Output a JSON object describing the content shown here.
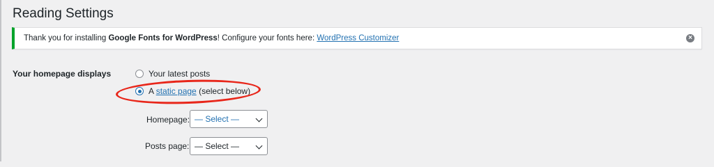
{
  "page": {
    "title": "Reading Settings"
  },
  "notice": {
    "text_prefix": "Thank you for installing ",
    "plugin_name": "Google Fonts for WordPress",
    "text_middle": "! Configure your fonts here: ",
    "link_text": "WordPress Customizer",
    "dismiss_glyph": "×",
    "accent_color": "#00a32a"
  },
  "homepage_displays": {
    "label": "Your homepage displays",
    "options": [
      {
        "label": "Your latest posts",
        "checked": false
      },
      {
        "prefix": "A ",
        "link": "static page",
        "suffix": " (select below)",
        "checked": true
      }
    ],
    "annotation_color": "#e8261a"
  },
  "homepage_select": {
    "label": "Homepage:",
    "value": "— Select —"
  },
  "posts_page_select": {
    "label": "Posts page:",
    "value": "— Select —"
  },
  "colors": {
    "link": "#2271b1",
    "background": "#f0f0f1"
  }
}
